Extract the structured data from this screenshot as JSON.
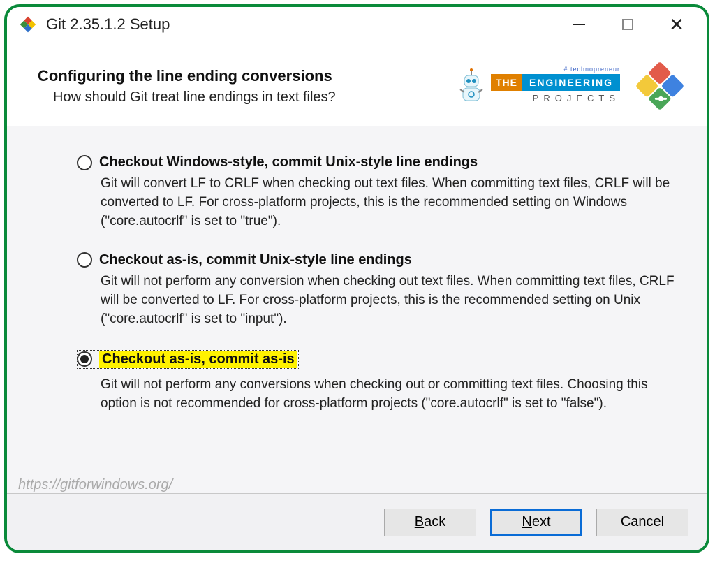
{
  "window": {
    "title": "Git 2.35.1.2 Setup"
  },
  "header": {
    "title": "Configuring the line ending conversions",
    "subtitle": "How should Git treat line endings in text files?"
  },
  "logo": {
    "tagline": "# technopreneur",
    "the": "THE",
    "eng": "ENGINEERING",
    "projects": "PROJECTS"
  },
  "options": [
    {
      "label": "Checkout Windows-style, commit Unix-style line endings",
      "desc": "Git will convert LF to CRLF when checking out text files. When committing text files, CRLF will be converted to LF. For cross-platform projects, this is the recommended setting on Windows (\"core.autocrlf\" is set to \"true\").",
      "selected": false
    },
    {
      "label": "Checkout as-is, commit Unix-style line endings",
      "desc": "Git will not perform any conversion when checking out text files. When committing text files, CRLF will be converted to LF. For cross-platform projects, this is the recommended setting on Unix (\"core.autocrlf\" is set to \"input\").",
      "selected": false
    },
    {
      "label": "Checkout as-is, commit as-is",
      "desc": "Git will not perform any conversions when checking out or committing text files. Choosing this option is not recommended for cross-platform projects (\"core.autocrlf\" is set to \"false\").",
      "selected": true
    }
  ],
  "footer_url": "https://gitforwindows.org/",
  "buttons": {
    "back": "Back",
    "next": "Next",
    "cancel": "Cancel"
  }
}
